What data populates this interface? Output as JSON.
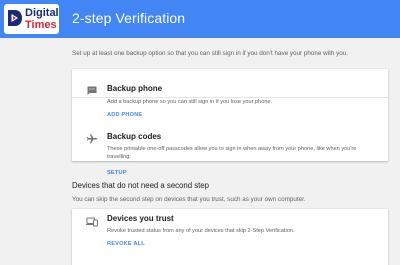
{
  "header": {
    "logo_line1": "Digital",
    "logo_line2": "Times",
    "title": "2-step Verification"
  },
  "intro": "Set up at least one backup option so that you can still sign in if you don't have your phone with you.",
  "backup_options": [
    {
      "icon": "message-icon",
      "title": "Backup phone",
      "description": "Add a backup phone so you can still sign in if you lose your phone.",
      "action": "ADD PHONE"
    },
    {
      "icon": "airplane-icon",
      "title": "Backup codes",
      "description": "These printable one-off passcodes allow you to sign in when away from your phone, like when you're travelling.",
      "action": "SETUP"
    }
  ],
  "second_section": {
    "heading": "Devices that do not need a second step",
    "intro": "You can skip the second step on devices that you trust, such as your own computer.",
    "devices": {
      "icon": "devices-icon",
      "title": "Devices you trust",
      "description": "Revoke trusted status from any of your devices that skip 2-Step Verification.",
      "action": "REVOKE ALL"
    }
  },
  "colors": {
    "header_bar": "#4285f4",
    "accent": "#4285f4",
    "background": "#f1f1f1",
    "logo_navy": "#1b2a78",
    "logo_red": "#d0283c"
  }
}
